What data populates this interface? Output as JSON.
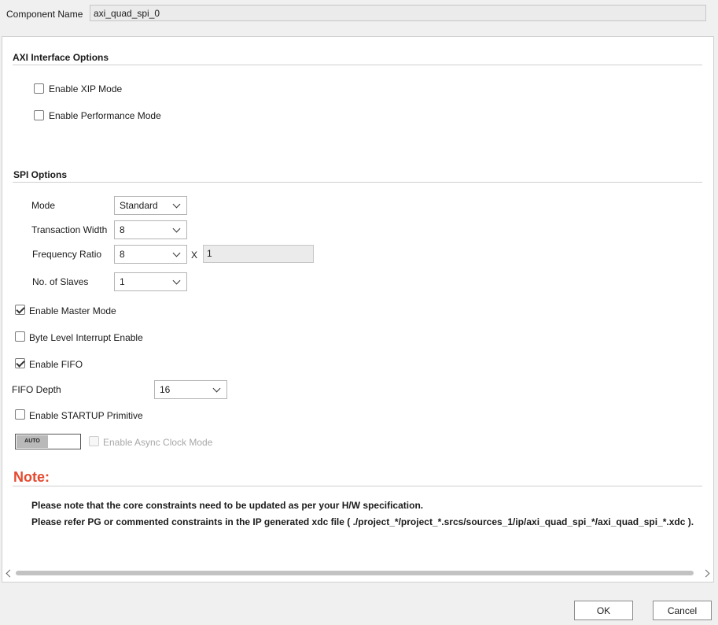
{
  "component": {
    "label": "Component Name",
    "value": "axi_quad_spi_0"
  },
  "axi_section": {
    "title": "AXI Interface Options",
    "xip_label": "Enable XIP Mode",
    "xip_checked": false,
    "perf_label": "Enable Performance Mode",
    "perf_checked": false
  },
  "spi_section": {
    "title": "SPI Options",
    "mode_label": "Mode",
    "mode_value": "Standard",
    "tw_label": "Transaction Width",
    "tw_value": "8",
    "fr_label": "Frequency Ratio",
    "fr_value": "8",
    "fr_x": "X",
    "fr_mult": "1",
    "slaves_label": "No. of Slaves",
    "slaves_value": "1",
    "master_label": "Enable Master Mode",
    "master_checked": true,
    "byte_label": "Byte Level Interrupt Enable",
    "byte_checked": false,
    "fifo_label": "Enable FIFO",
    "fifo_checked": true,
    "fifo_depth_label": "FIFO Depth",
    "fifo_depth_value": "16",
    "startup_label": "Enable STARTUP Primitive",
    "startup_checked": false,
    "auto_label": "AUTO",
    "async_label": "Enable Async Clock Mode",
    "async_checked": false
  },
  "note": {
    "title": "Note:",
    "line1": "Please note that the core constraints need to be updated as per your H/W specification.",
    "line2": "Please refer PG or commented constraints in the IP generated xdc file ( ./project_*/project_*.srcs/sources_1/ip/axi_quad_spi_*/axi_quad_spi_*.xdc )."
  },
  "buttons": {
    "ok": "OK",
    "cancel": "Cancel"
  },
  "icons": {
    "dropdown": "chevron-down-icon",
    "scroll_left": "chevron-left-icon",
    "scroll_right": "chevron-right-icon",
    "check": "checkmark-icon"
  },
  "colors": {
    "note_accent": "#e5492f",
    "panel_bg": "#ffffff",
    "window_bg": "#f0f0f0"
  }
}
